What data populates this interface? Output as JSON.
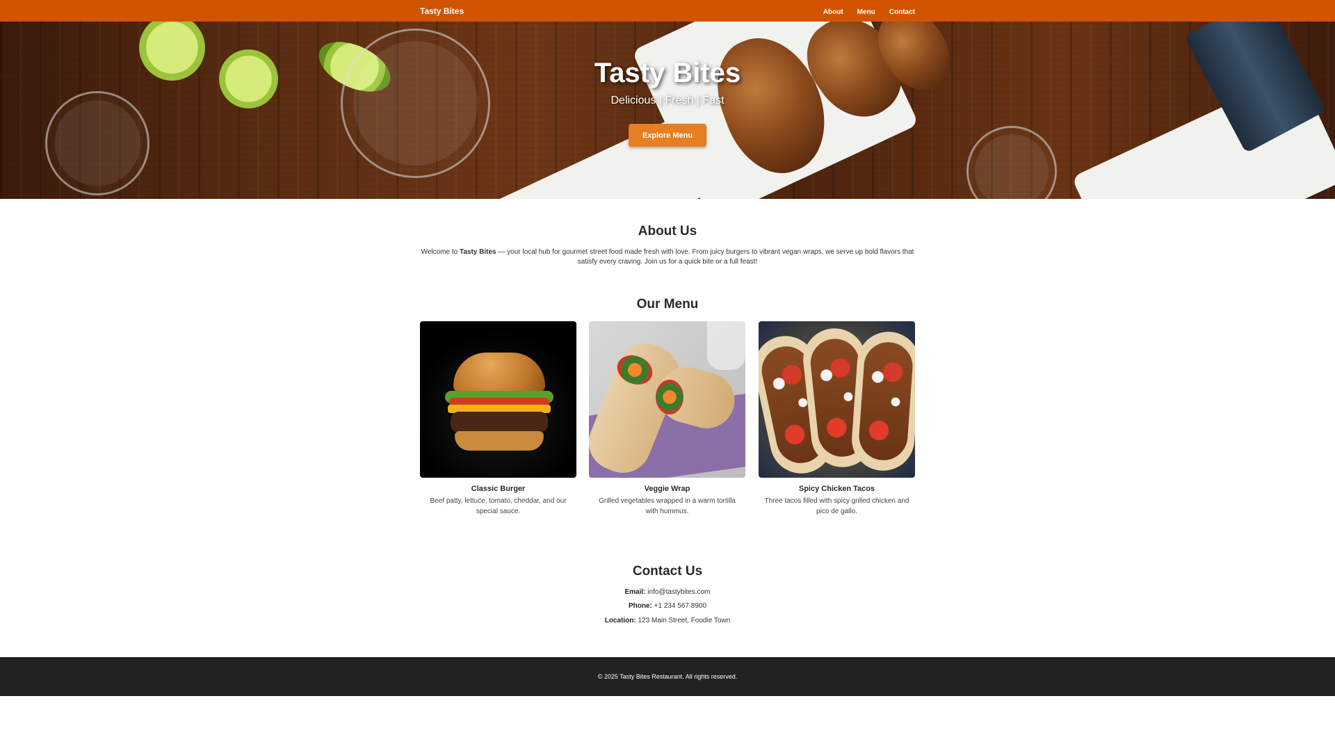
{
  "navbar": {
    "brand": "Tasty Bites",
    "links": [
      "About",
      "Menu",
      "Contact"
    ]
  },
  "hero": {
    "title": "Tasty Bites",
    "subtitle": "Delicious | Fresh | Fast",
    "button_label": "Explore Menu"
  },
  "about": {
    "heading": "About Us",
    "text_before": "Welcome to ",
    "text_bold": "Tasty Bites",
    "text_after": " — your local hub for gourmet street food made fresh with love. From juicy burgers to vibrant vegan wraps, we serve up bold flavors that satisfy every craving. Join us for a quick bite or a full feast!"
  },
  "menu": {
    "heading": "Our Menu",
    "items": [
      {
        "name": "Classic Burger",
        "description": "Beef patty, lettuce, tomato, cheddar, and our special sauce."
      },
      {
        "name": "Veggie Wrap",
        "description": "Grilled vegetables wrapped in a warm tortilla with hummus."
      },
      {
        "name": "Spicy Chicken Tacos",
        "description": "Three tacos filled with spicy grilled chicken and pico de gallo."
      }
    ]
  },
  "contact": {
    "heading": "Contact Us",
    "email_label": "Email:",
    "email_value": " info@tastybites.com",
    "phone_label": "Phone:",
    "phone_value": " +1 234 567 8900",
    "location_label": "Location:",
    "location_value": " 123 Main Street, Foodie Town"
  },
  "footer": {
    "text": "© 2025 Tasty Bites Restaurant. All rights reserved."
  },
  "colors": {
    "navbar": "#d35400",
    "button": "#e67e22",
    "footer": "#222222"
  }
}
